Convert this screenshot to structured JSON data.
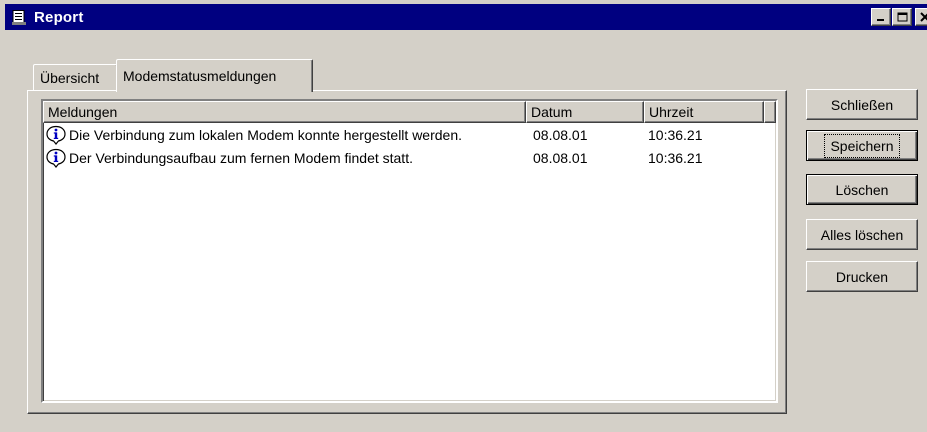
{
  "window": {
    "title": "Report",
    "controls": [
      "minimize-icon",
      "maximize-icon",
      "close-icon"
    ]
  },
  "tabs": [
    {
      "label": "Übersicht",
      "active": false
    },
    {
      "label": "Modemstatusmeldungen",
      "active": true
    }
  ],
  "list": {
    "columns": [
      "Meldungen",
      "Datum",
      "Uhrzeit"
    ],
    "rows": [
      {
        "icon": "info-icon",
        "message": "Die Verbindung zum lokalen Modem konnte hergestellt werden.",
        "date": "08.08.01",
        "time": "10:36.21"
      },
      {
        "icon": "info-icon",
        "message": "Der Verbindungsaufbau zum fernen Modem findet statt.",
        "date": "08.08.01",
        "time": "10:36.21"
      }
    ]
  },
  "buttons": {
    "close": "Schließen",
    "save": "Speichern",
    "delete": "Löschen",
    "delete_all": "Alles löschen",
    "print": "Drucken"
  }
}
